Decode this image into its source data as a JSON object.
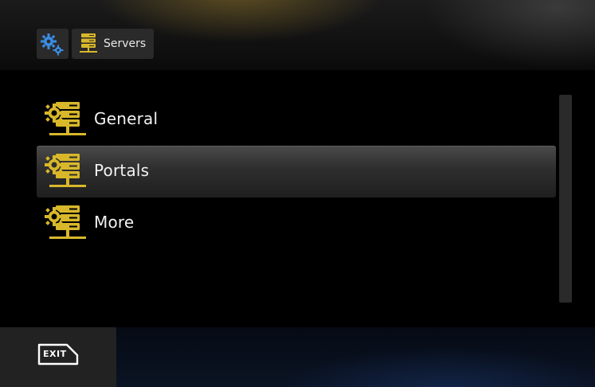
{
  "breadcrumb": {
    "settings_icon": "gears-icon",
    "servers_label": "Servers",
    "servers_icon": "server-icon"
  },
  "menu": {
    "items": [
      {
        "label": "General",
        "icon": "server-gear-icon",
        "selected": false
      },
      {
        "label": "Portals",
        "icon": "server-gear-icon",
        "selected": true
      },
      {
        "label": "More",
        "icon": "server-gear-icon",
        "selected": false
      }
    ]
  },
  "footer": {
    "exit_label": "EXIT"
  },
  "colors": {
    "accent_gold": "#d8b82a",
    "gear_blue": "#2f7fd6",
    "background": "#000000"
  }
}
